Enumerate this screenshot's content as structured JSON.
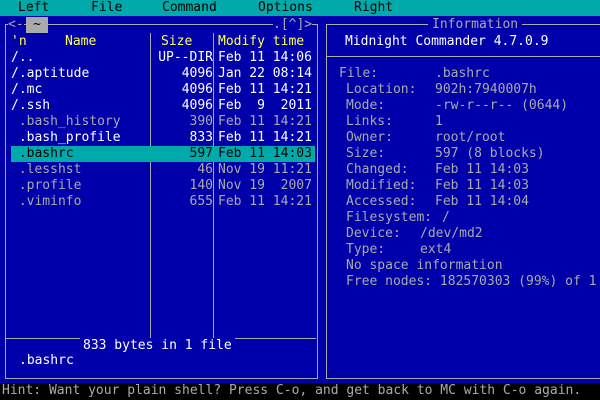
{
  "menu": [
    "Left",
    "File",
    "Command",
    "Options",
    "Right"
  ],
  "left_panel": {
    "path": "~",
    "history_markers": ".[^]>",
    "left_marker": "<-",
    "columns": {
      "sort": "'n",
      "name": "Name",
      "size": "Size",
      "time": "Modify time"
    },
    "rows": [
      {
        "name": "/..",
        "size": "UP--DIR",
        "time": "Feb 11 14:06",
        "kind": "dir"
      },
      {
        "name": "/.aptitude",
        "size": "4096",
        "time": "Jan 22 08:14",
        "kind": "dir"
      },
      {
        "name": "/.mc",
        "size": "4096",
        "time": "Feb 11 14:21",
        "kind": "dir"
      },
      {
        "name": "/.ssh",
        "size": "4096",
        "time": "Feb  9  2011",
        "kind": "dir"
      },
      {
        "name": " .bash_history",
        "size": "390",
        "time": "Feb 11 14:21",
        "kind": "file"
      },
      {
        "name": " .bash_profile",
        "size": "833",
        "time": "Feb 11 14:21",
        "kind": "dir"
      },
      {
        "name": " .bashrc",
        "size": "597",
        "time": "Feb 11 14:03",
        "kind": "selected"
      },
      {
        "name": " .lesshst",
        "size": "46",
        "time": "Nov 19 11:21",
        "kind": "file"
      },
      {
        "name": " .profile",
        "size": "140",
        "time": "Nov 19  2007",
        "kind": "file"
      },
      {
        "name": " .viminfo",
        "size": "655",
        "time": "Feb 11 14:21",
        "kind": "file"
      }
    ],
    "summary": "833 bytes in 1 file",
    "mini_status": ".bashrc"
  },
  "right_panel": {
    "title": "Information",
    "version": "Midnight Commander 4.7.0.9",
    "fields": [
      {
        "label": "File:",
        "value": ".bashrc",
        "indent": 0
      },
      {
        "label": "Location:",
        "value": "902h:7940007h",
        "indent": 1
      },
      {
        "label": "Mode:",
        "value": "-rw-r--r-- (0644)",
        "indent": 1
      },
      {
        "label": "Links:",
        "value": "1",
        "indent": 1
      },
      {
        "label": "Owner:",
        "value": "root/root",
        "indent": 1
      },
      {
        "label": "Size:",
        "value": "597 (8 blocks)",
        "indent": 1
      },
      {
        "label": "Changed:",
        "value": "Feb 11 14:03",
        "indent": 1
      },
      {
        "label": "Modified:",
        "value": "Feb 11 14:03",
        "indent": 1
      },
      {
        "label": "Accessed:",
        "value": "Feb 11 14:04",
        "indent": 1
      },
      {
        "label": "Filesystem:",
        "value": "/",
        "indent": 1
      },
      {
        "label": "Device:",
        "value": "/dev/md2",
        "indent": 1
      },
      {
        "label": "Type:",
        "value": "ext4",
        "indent": 1
      }
    ],
    "extra_lines": [
      "No space information",
      "Free nodes: 182570303 (99%) of 1"
    ]
  },
  "hint": "Hint: Want your plain shell? Press C-o, and get back to MC with C-o again.",
  "colors": {
    "background": "#0000aa",
    "accent": "#00aaaa",
    "header": "#ffff55"
  }
}
